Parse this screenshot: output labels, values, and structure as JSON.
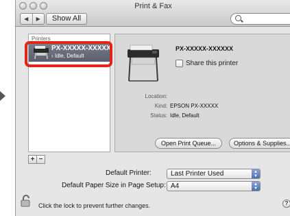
{
  "window": {
    "title": "Print & Fax"
  },
  "toolbar": {
    "back_icon": "back-arrow-icon",
    "forward_icon": "forward-arrow-icon",
    "show_all_label": "Show All",
    "search_placeholder": ""
  },
  "printers": {
    "header": "Printers",
    "items": [
      {
        "name": "PX-XXXXX-XXXXX",
        "status": "Idle, Default",
        "icon": "printer-icon"
      }
    ]
  },
  "detail": {
    "printer_name": "PX-XXXXX-XXXXXX",
    "share_label": "Share this printer",
    "location_label": "Location:",
    "location_value": "",
    "kind_label": "Kind:",
    "kind_value": "EPSON PX-XXXXX",
    "status_label": "Status:",
    "status_value": "Idle, Default",
    "open_queue_label": "Open Print Queue...",
    "options_label": "Options & Supplies..."
  },
  "list_controls": {
    "add_label": "+",
    "remove_label": "−"
  },
  "defaults": {
    "default_printer_label": "Default Printer:",
    "default_printer_value": "Last Printer Used",
    "paper_size_label": "Default Paper Size in Page Setup:",
    "paper_size_value": "A4"
  },
  "footer": {
    "lock_text": "Click the lock to prevent further changes.",
    "help_label": "?"
  },
  "colors": {
    "selection": "#5e6371",
    "highlight_box": "#e1251b",
    "window_bg": "#e6e6e6"
  }
}
